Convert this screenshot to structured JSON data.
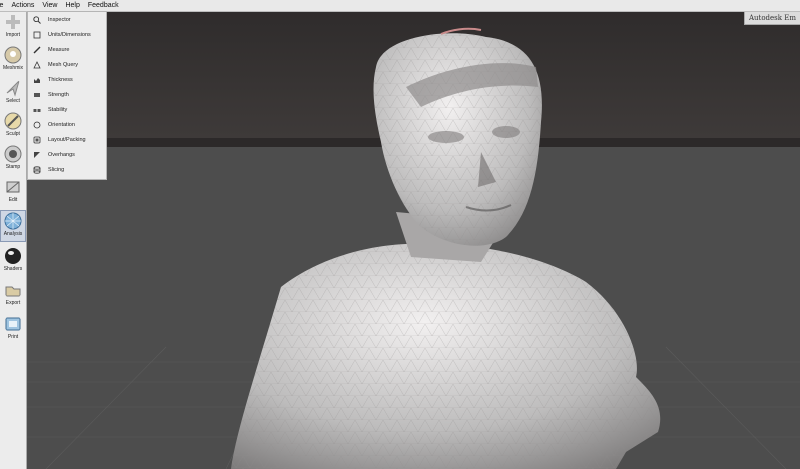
{
  "menu": [
    "le",
    "Actions",
    "View",
    "Help",
    "Feedback"
  ],
  "brand": "Autodesk Em",
  "tools": [
    {
      "label": "Import",
      "icon": "plus-icon"
    },
    {
      "label": "Meshmix",
      "icon": "meshmix-icon"
    },
    {
      "label": "Select",
      "icon": "arrow-cursor-icon"
    },
    {
      "label": "Sculpt",
      "icon": "brush-icon"
    },
    {
      "label": "Stamp",
      "icon": "stamp-icon"
    },
    {
      "label": "Edit",
      "icon": "edit-icon"
    },
    {
      "label": "Analysis",
      "icon": "mesh-sphere-icon",
      "active": true
    },
    {
      "label": "Shaders",
      "icon": "shader-ball-icon"
    },
    {
      "label": "Export",
      "icon": "export-icon"
    },
    {
      "label": "Print",
      "icon": "print-icon"
    }
  ],
  "analysis_menu": [
    {
      "label": "Inspector",
      "icon": "magnifier-icon"
    },
    {
      "label": "Units/Dimensions",
      "icon": "units-icon"
    },
    {
      "label": "Measure",
      "icon": "ruler-icon"
    },
    {
      "label": "Mesh Query",
      "icon": "mesh-query-icon"
    },
    {
      "label": "Thickness",
      "icon": "thickness-icon"
    },
    {
      "label": "Strength",
      "icon": "strength-icon"
    },
    {
      "label": "Stability",
      "icon": "stability-icon"
    },
    {
      "label": "Orientation",
      "icon": "orientation-icon"
    },
    {
      "label": "Layout/Packing",
      "icon": "layout-icon"
    },
    {
      "label": "Overhangs",
      "icon": "overhang-icon"
    },
    {
      "label": "Slicing",
      "icon": "slicing-icon"
    }
  ],
  "colors": {
    "background_top": "#3b3838",
    "floor": "#4d4d4d",
    "mesh": "#d2d2d2",
    "panel": "#ececec"
  }
}
